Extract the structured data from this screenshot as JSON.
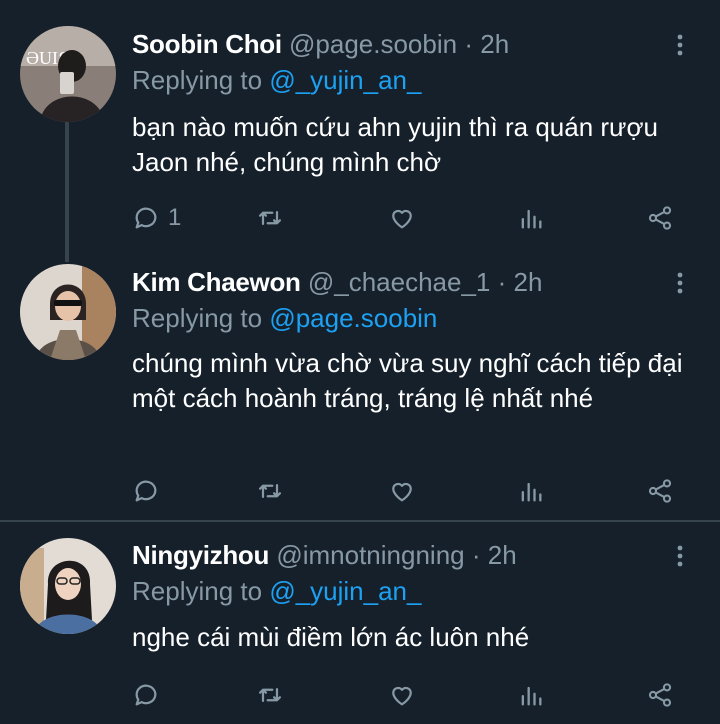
{
  "colors": {
    "background": "#15202b",
    "text": "#ffffff",
    "muted": "#8899a6",
    "accent": "#1da1f2",
    "divider": "#38444d"
  },
  "tweets": [
    {
      "name": "Soobin Choi",
      "handle": "@page.soobin",
      "separator": "·",
      "time": "2h",
      "reply_prefix": "Replying to ",
      "reply_to": "@_yujin_an_",
      "text": "bạn nào muốn cứu ahn yujin thì ra quán rượu Jaon nhé, chúng mình chờ",
      "reply_count": "1",
      "icons": [
        "reply-icon",
        "retweet-icon",
        "like-icon",
        "analytics-icon",
        "share-icon",
        "more-icon"
      ]
    },
    {
      "name": "Kim Chaewon",
      "handle": "@_chaechae_1",
      "separator": "·",
      "time": "2h",
      "reply_prefix": "Replying to ",
      "reply_to": "@page.soobin",
      "text": "chúng mình vừa chờ vừa suy nghĩ cách tiếp đại một cách hoành tráng, tráng lệ nhất nhé",
      "reply_count": "",
      "icons": [
        "reply-icon",
        "retweet-icon",
        "like-icon",
        "analytics-icon",
        "share-icon",
        "more-icon"
      ]
    },
    {
      "name": "Ningyizhou",
      "handle": "@imnotningning",
      "separator": "·",
      "time": "2h",
      "reply_prefix": "Replying to ",
      "reply_to": "@_yujin_an_",
      "text": "nghe cái mùi điềm lớn ác luôn nhé",
      "reply_count": "",
      "icons": [
        "reply-icon",
        "retweet-icon",
        "like-icon",
        "analytics-icon",
        "share-icon",
        "more-icon"
      ]
    }
  ]
}
